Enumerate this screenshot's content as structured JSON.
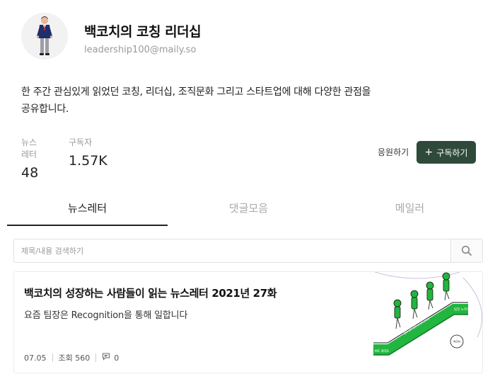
{
  "profile": {
    "title": "백코치의 코칭 리더십",
    "email": "leadership100@maily.so",
    "description": "한 주간 관심있게 읽었던 코칭, 리더십, 조직문화 그리고 스타트업에 대해 다양한 관점을 공유합니다."
  },
  "stats": {
    "newsletters_label": "뉴스레터",
    "newsletters_value": "48",
    "subscribers_label": "구독자",
    "subscribers_value": "1.57K"
  },
  "actions": {
    "support_label": "응원하기",
    "subscribe_label": "구독하기",
    "subscribe_icon": "plus-icon"
  },
  "tabs": [
    {
      "label": "뉴스레터",
      "active": true
    },
    {
      "label": "댓글모음",
      "active": false
    },
    {
      "label": "메일러",
      "active": false
    }
  ],
  "search": {
    "placeholder": "제목/내용 검색하기",
    "icon": "search-icon"
  },
  "post": {
    "title": "백코치의 성장하는 사람들이 읽는 뉴스레터 2021년 27화",
    "subtitle": "요즘 팀장은 Recognition을 통해 일합니다",
    "date": "07.05",
    "views": "조회 560",
    "comments": "0",
    "thumbnail": {
      "label_mz": "MZ 세대도",
      "label_top": "팀장 노하우",
      "label_escalator": "알고 싶은 업무 방식에 대하여",
      "badge": "백코치"
    }
  },
  "colors": {
    "accent": "#2f4a3a",
    "escalator_green": "#22b53f"
  }
}
